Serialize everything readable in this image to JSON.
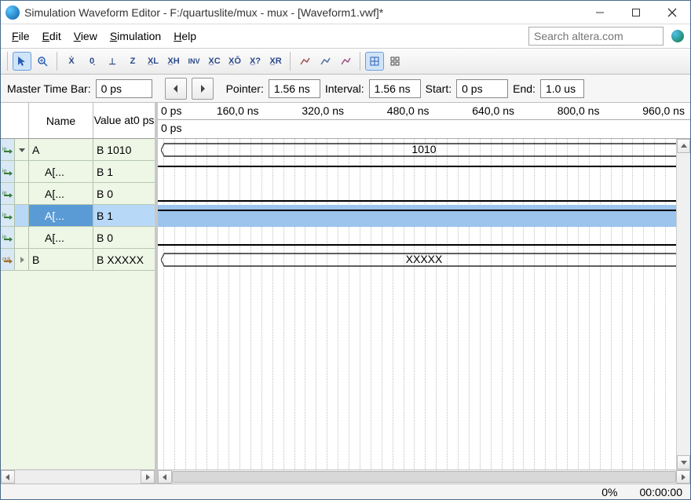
{
  "title": "Simulation Waveform Editor - F:/quartuslite/mux - mux - [Waveform1.vwf]*",
  "menus": {
    "file": "File",
    "edit": "Edit",
    "view": "View",
    "simulation": "Simulation",
    "help": "Help"
  },
  "search_placeholder": "Search altera.com",
  "timebar": {
    "master_label": "Master Time Bar:",
    "master_value": "0 ps",
    "pointer_label": "Pointer:",
    "pointer_value": "1.56 ns",
    "interval_label": "Interval:",
    "interval_value": "1.56 ns",
    "start_label": "Start:",
    "start_value": "0 ps",
    "end_label": "End:",
    "end_value": "1.0 us"
  },
  "sig_header": {
    "name": "Name",
    "value_at": "Value at",
    "value_time": "0 ps"
  },
  "signals": [
    {
      "dir": "in",
      "expand": "down",
      "indent": 0,
      "name": "A",
      "value": "B 1010",
      "selected": false
    },
    {
      "dir": "in",
      "expand": "",
      "indent": 1,
      "name": "A[...",
      "value": "B 1",
      "selected": false
    },
    {
      "dir": "in",
      "expand": "",
      "indent": 1,
      "name": "A[...",
      "value": "B 0",
      "selected": false
    },
    {
      "dir": "in",
      "expand": "",
      "indent": 1,
      "name": "A[...",
      "value": "B 1",
      "selected": true
    },
    {
      "dir": "in",
      "expand": "",
      "indent": 1,
      "name": "A[...",
      "value": "B 0",
      "selected": false
    },
    {
      "dir": "out",
      "expand": "right",
      "indent": 0,
      "name": "B",
      "value": "B XXXXX",
      "selected": false
    }
  ],
  "ruler": {
    "zero": "0 ps",
    "ticks": [
      "160,0 ns",
      "320,0 ns",
      "480,0 ns",
      "640,0 ns",
      "800,0 ns",
      "960,0 ns"
    ]
  },
  "marker_label": "0 ps",
  "wave_labels": {
    "bus_A": "1010",
    "bus_B": "XXXXX"
  },
  "status": {
    "left": "0%",
    "right": "00:00:00"
  }
}
